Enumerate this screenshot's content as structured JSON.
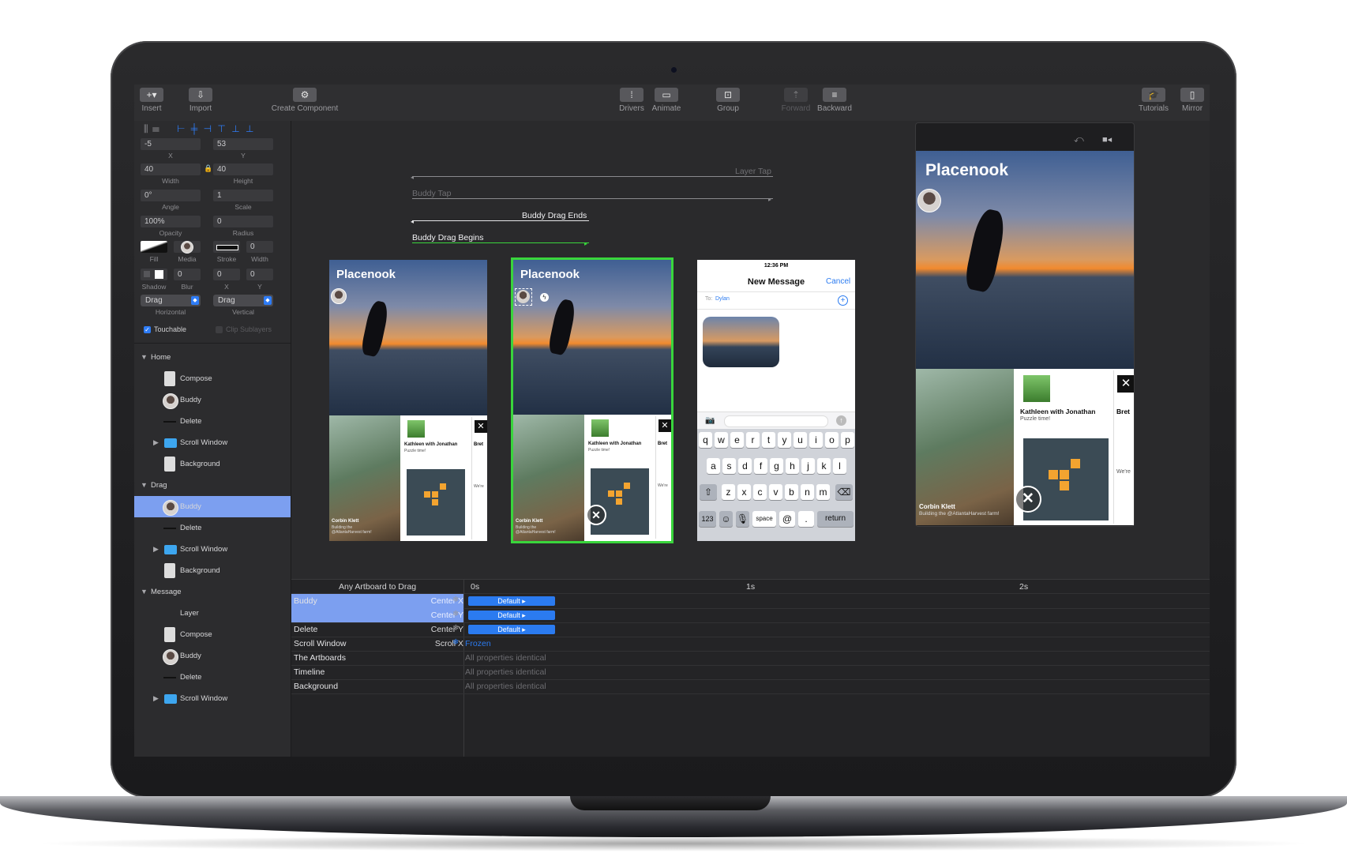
{
  "toolbar": {
    "insert": "Insert",
    "import": "Import",
    "create_component": "Create Component",
    "drivers": "Drivers",
    "animate": "Animate",
    "group": "Group",
    "forward": "Forward",
    "backward": "Backward",
    "tutorials": "Tutorials",
    "mirror": "Mirror"
  },
  "inspector": {
    "x": "-5",
    "y": "53",
    "x_label": "X",
    "y_label": "Y",
    "width": "40",
    "height": "40",
    "width_label": "Width",
    "height_label": "Height",
    "angle": "0°",
    "scale": "1",
    "angle_label": "Angle",
    "scale_label": "Scale",
    "opacity": "100%",
    "radius": "0",
    "opacity_label": "Opacity",
    "radius_label": "Radius",
    "stroke_width": "0",
    "fill_label": "Fill",
    "media_label": "Media",
    "stroke_label": "Stroke",
    "stroke_width_label": "Width",
    "blur": "0",
    "shadow_x": "0",
    "shadow_y": "0",
    "shadow_label": "Shadow",
    "blur_label": "Blur",
    "sx_label": "X",
    "sy_label": "Y",
    "horizontal": "Drag",
    "vertical": "Drag",
    "horizontal_label": "Horizontal",
    "vertical_label": "Vertical",
    "touchable": "Touchable",
    "clip_sublayers": "Clip Sublayers"
  },
  "layers": [
    {
      "label": "Home",
      "kind": "group"
    },
    {
      "label": "Compose",
      "kind": "thumb"
    },
    {
      "label": "Buddy",
      "kind": "avatar"
    },
    {
      "label": "Delete",
      "kind": "dash"
    },
    {
      "label": "Scroll Window",
      "kind": "folder"
    },
    {
      "label": "Background",
      "kind": "thumb"
    },
    {
      "label": "Drag",
      "kind": "group"
    },
    {
      "label": "Buddy",
      "kind": "avatar",
      "selected": true
    },
    {
      "label": "Delete",
      "kind": "dash"
    },
    {
      "label": "Scroll Window",
      "kind": "folder"
    },
    {
      "label": "Background",
      "kind": "thumb"
    },
    {
      "label": "Message",
      "kind": "group"
    },
    {
      "label": "Layer",
      "kind": "none"
    },
    {
      "label": "Compose",
      "kind": "thumb"
    },
    {
      "label": "Buddy",
      "kind": "avatar"
    },
    {
      "label": "Delete",
      "kind": "dash"
    },
    {
      "label": "Scroll Window",
      "kind": "folder"
    }
  ],
  "canvas": {
    "layer_tap": "Layer Tap",
    "buddy_tap": "Buddy Tap",
    "drag_ends": "Buddy Drag Ends",
    "drag_begins": "Buddy Drag Begins",
    "app_title": "Placenook",
    "card_title": "Kathleen with Jonathan",
    "card_sub": "Puzzle time!",
    "card_partial": "Bret",
    "card_were": "We're",
    "photo_name": "Corbin Klett",
    "photo_caption": "Building the @AtlantaHarvest farm!",
    "message": {
      "time": "12:36 PM",
      "title": "New Message",
      "cancel": "Cancel",
      "to_label": "To:",
      "to_value": "Dylan",
      "row1": [
        "q",
        "w",
        "e",
        "r",
        "t",
        "y",
        "u",
        "i",
        "o",
        "p"
      ],
      "row2": [
        "a",
        "s",
        "d",
        "f",
        "g",
        "h",
        "j",
        "k",
        "l"
      ],
      "row3": [
        "z",
        "x",
        "c",
        "v",
        "b",
        "n",
        "m"
      ],
      "numbers": "123",
      "space": "space",
      "at": "@",
      "dot": ".",
      "return": "return"
    }
  },
  "timeline": {
    "header": "Any Artboard to Drag",
    "ticks": [
      "0s",
      "1s",
      "2s"
    ],
    "rows": [
      {
        "name": "Buddy",
        "prop": "Center X",
        "value": "Default",
        "type": "pill",
        "selected": true
      },
      {
        "name": "",
        "prop": "Center Y",
        "value": "Default",
        "type": "pill",
        "selected": true
      },
      {
        "name": "Delete",
        "prop": "Center Y",
        "value": "Default",
        "type": "pill"
      },
      {
        "name": "Scroll Window",
        "prop": "Scroll X",
        "value": "Frozen",
        "type": "frozen"
      },
      {
        "name": "The Artboards",
        "prop": "",
        "value": "All properties identical",
        "type": "text"
      },
      {
        "name": "Timeline",
        "prop": "",
        "value": "All properties identical",
        "type": "text"
      },
      {
        "name": "Background",
        "prop": "",
        "value": "All properties identical",
        "type": "text"
      }
    ]
  },
  "colors": {
    "accent": "#2b7bf0",
    "selection": "#7c9ff0",
    "active_artboard": "#39d53c",
    "drag_begins": "#39d53c"
  }
}
